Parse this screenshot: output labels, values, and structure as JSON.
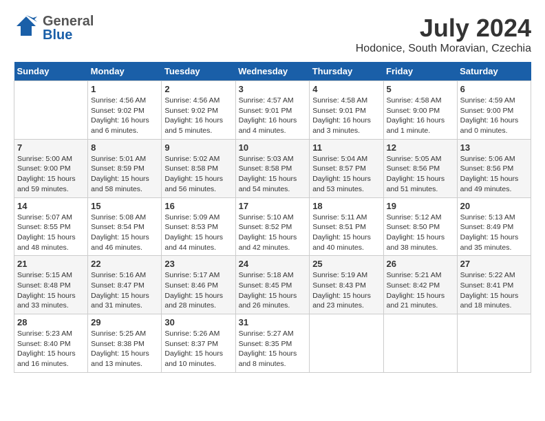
{
  "logo": {
    "line1": "General",
    "line2": "Blue"
  },
  "title": "July 2024",
  "subtitle": "Hodonice, South Moravian, Czechia",
  "days_of_week": [
    "Sunday",
    "Monday",
    "Tuesday",
    "Wednesday",
    "Thursday",
    "Friday",
    "Saturday"
  ],
  "weeks": [
    [
      {
        "day": "",
        "info": ""
      },
      {
        "day": "1",
        "info": "Sunrise: 4:56 AM\nSunset: 9:02 PM\nDaylight: 16 hours\nand 6 minutes."
      },
      {
        "day": "2",
        "info": "Sunrise: 4:56 AM\nSunset: 9:02 PM\nDaylight: 16 hours\nand 5 minutes."
      },
      {
        "day": "3",
        "info": "Sunrise: 4:57 AM\nSunset: 9:01 PM\nDaylight: 16 hours\nand 4 minutes."
      },
      {
        "day": "4",
        "info": "Sunrise: 4:58 AM\nSunset: 9:01 PM\nDaylight: 16 hours\nand 3 minutes."
      },
      {
        "day": "5",
        "info": "Sunrise: 4:58 AM\nSunset: 9:00 PM\nDaylight: 16 hours\nand 1 minute."
      },
      {
        "day": "6",
        "info": "Sunrise: 4:59 AM\nSunset: 9:00 PM\nDaylight: 16 hours\nand 0 minutes."
      }
    ],
    [
      {
        "day": "7",
        "info": "Sunrise: 5:00 AM\nSunset: 9:00 PM\nDaylight: 15 hours\nand 59 minutes."
      },
      {
        "day": "8",
        "info": "Sunrise: 5:01 AM\nSunset: 8:59 PM\nDaylight: 15 hours\nand 58 minutes."
      },
      {
        "day": "9",
        "info": "Sunrise: 5:02 AM\nSunset: 8:58 PM\nDaylight: 15 hours\nand 56 minutes."
      },
      {
        "day": "10",
        "info": "Sunrise: 5:03 AM\nSunset: 8:58 PM\nDaylight: 15 hours\nand 54 minutes."
      },
      {
        "day": "11",
        "info": "Sunrise: 5:04 AM\nSunset: 8:57 PM\nDaylight: 15 hours\nand 53 minutes."
      },
      {
        "day": "12",
        "info": "Sunrise: 5:05 AM\nSunset: 8:56 PM\nDaylight: 15 hours\nand 51 minutes."
      },
      {
        "day": "13",
        "info": "Sunrise: 5:06 AM\nSunset: 8:56 PM\nDaylight: 15 hours\nand 49 minutes."
      }
    ],
    [
      {
        "day": "14",
        "info": "Sunrise: 5:07 AM\nSunset: 8:55 PM\nDaylight: 15 hours\nand 48 minutes."
      },
      {
        "day": "15",
        "info": "Sunrise: 5:08 AM\nSunset: 8:54 PM\nDaylight: 15 hours\nand 46 minutes."
      },
      {
        "day": "16",
        "info": "Sunrise: 5:09 AM\nSunset: 8:53 PM\nDaylight: 15 hours\nand 44 minutes."
      },
      {
        "day": "17",
        "info": "Sunrise: 5:10 AM\nSunset: 8:52 PM\nDaylight: 15 hours\nand 42 minutes."
      },
      {
        "day": "18",
        "info": "Sunrise: 5:11 AM\nSunset: 8:51 PM\nDaylight: 15 hours\nand 40 minutes."
      },
      {
        "day": "19",
        "info": "Sunrise: 5:12 AM\nSunset: 8:50 PM\nDaylight: 15 hours\nand 38 minutes."
      },
      {
        "day": "20",
        "info": "Sunrise: 5:13 AM\nSunset: 8:49 PM\nDaylight: 15 hours\nand 35 minutes."
      }
    ],
    [
      {
        "day": "21",
        "info": "Sunrise: 5:15 AM\nSunset: 8:48 PM\nDaylight: 15 hours\nand 33 minutes."
      },
      {
        "day": "22",
        "info": "Sunrise: 5:16 AM\nSunset: 8:47 PM\nDaylight: 15 hours\nand 31 minutes."
      },
      {
        "day": "23",
        "info": "Sunrise: 5:17 AM\nSunset: 8:46 PM\nDaylight: 15 hours\nand 28 minutes."
      },
      {
        "day": "24",
        "info": "Sunrise: 5:18 AM\nSunset: 8:45 PM\nDaylight: 15 hours\nand 26 minutes."
      },
      {
        "day": "25",
        "info": "Sunrise: 5:19 AM\nSunset: 8:43 PM\nDaylight: 15 hours\nand 23 minutes."
      },
      {
        "day": "26",
        "info": "Sunrise: 5:21 AM\nSunset: 8:42 PM\nDaylight: 15 hours\nand 21 minutes."
      },
      {
        "day": "27",
        "info": "Sunrise: 5:22 AM\nSunset: 8:41 PM\nDaylight: 15 hours\nand 18 minutes."
      }
    ],
    [
      {
        "day": "28",
        "info": "Sunrise: 5:23 AM\nSunset: 8:40 PM\nDaylight: 15 hours\nand 16 minutes."
      },
      {
        "day": "29",
        "info": "Sunrise: 5:25 AM\nSunset: 8:38 PM\nDaylight: 15 hours\nand 13 minutes."
      },
      {
        "day": "30",
        "info": "Sunrise: 5:26 AM\nSunset: 8:37 PM\nDaylight: 15 hours\nand 10 minutes."
      },
      {
        "day": "31",
        "info": "Sunrise: 5:27 AM\nSunset: 8:35 PM\nDaylight: 15 hours\nand 8 minutes."
      },
      {
        "day": "",
        "info": ""
      },
      {
        "day": "",
        "info": ""
      },
      {
        "day": "",
        "info": ""
      }
    ]
  ]
}
